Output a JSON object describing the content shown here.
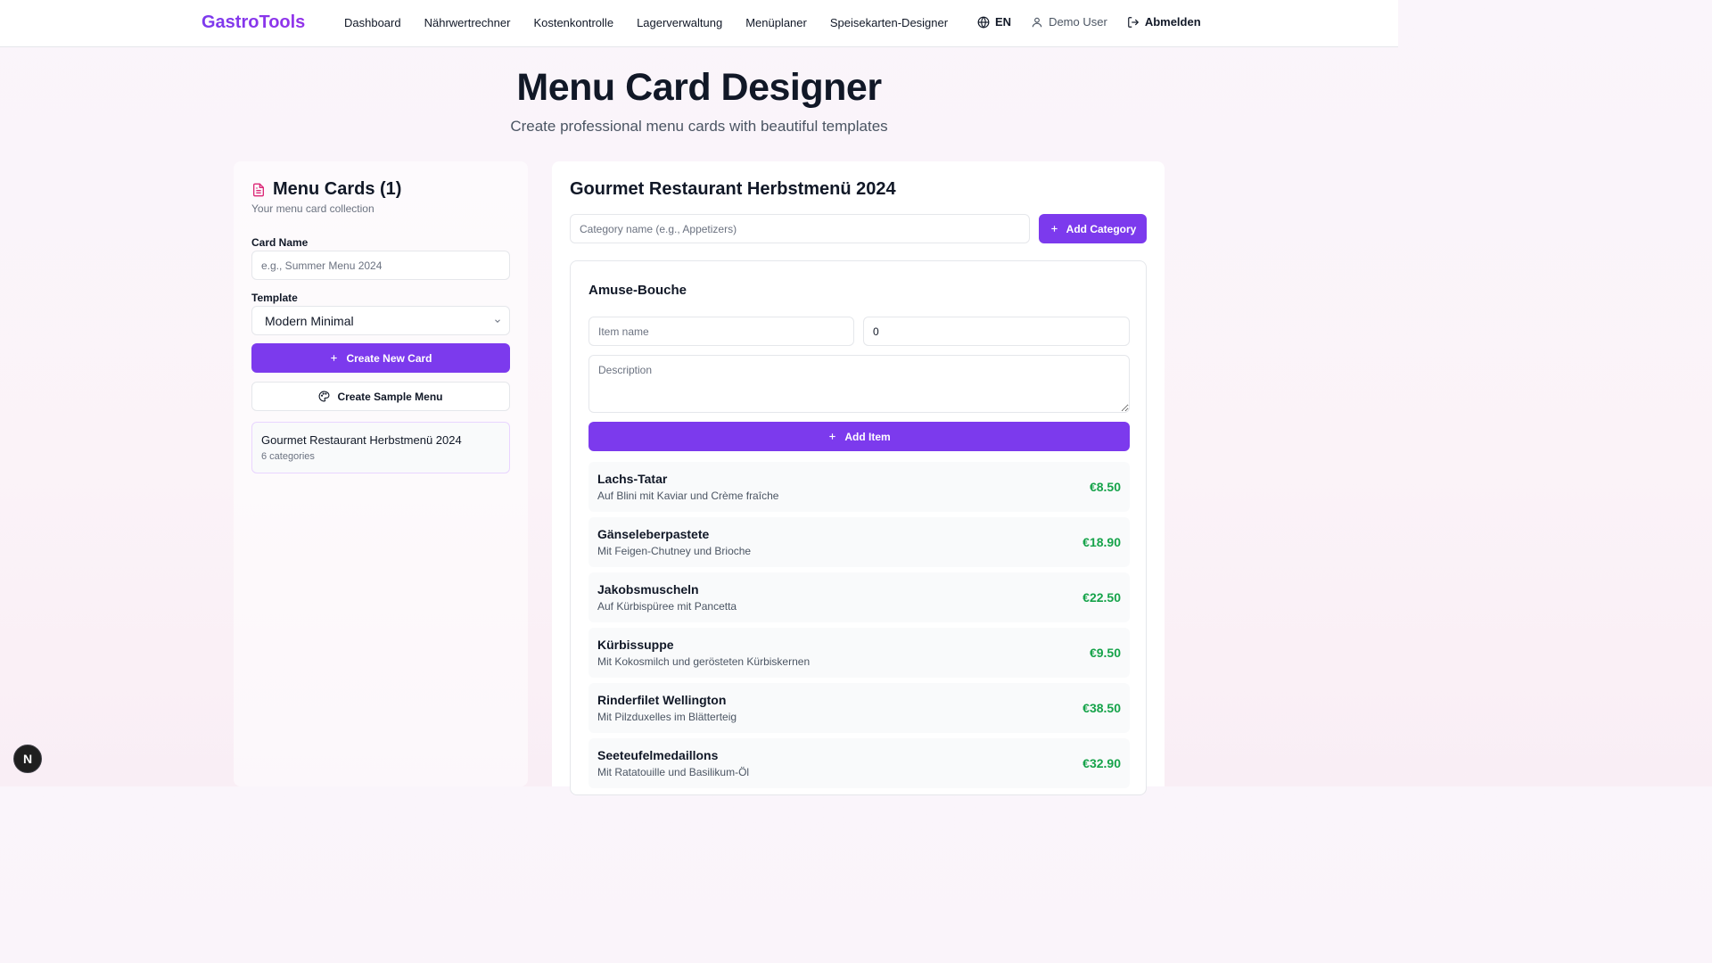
{
  "app": {
    "logo": "GastroTools"
  },
  "nav": {
    "links": [
      "Dashboard",
      "Nährwertrechner",
      "Kostenkontrolle",
      "Lagerverwaltung",
      "Menüplaner",
      "Speisekarten-Designer"
    ],
    "language": "EN",
    "user": "Demo User",
    "logout": "Abmelden"
  },
  "page": {
    "title": "Menu Card Designer",
    "subtitle": "Create professional menu cards with beautiful templates"
  },
  "left": {
    "title": "Menu Cards (1)",
    "description": "Your menu card collection",
    "card_name_label": "Card Name",
    "card_name_placeholder": "e.g., Summer Menu 2024",
    "template_label": "Template",
    "template_value": "Modern Minimal",
    "create_button": "Create New Card",
    "sample_button": "Create Sample Menu",
    "cards": [
      {
        "name": "Gourmet Restaurant Herbstmenü 2024",
        "meta": "6 categories"
      }
    ]
  },
  "right": {
    "title": "Gourmet Restaurant Herbstmenü 2024",
    "category_placeholder": "Category name (e.g., Appetizers)",
    "add_category_button": "Add Category",
    "category": {
      "name": "Amuse-Bouche",
      "item_name_placeholder": "Item name",
      "price_value": "0",
      "description_placeholder": "Description",
      "add_item_button": "Add Item",
      "items": [
        {
          "name": "Lachs-Tatar",
          "description": "Auf Blini mit Kaviar und Crème fraîche",
          "price": "€8.50"
        },
        {
          "name": "Gänseleberpastete",
          "description": "Mit Feigen-Chutney und Brioche",
          "price": "€18.90"
        },
        {
          "name": "Jakobsmuscheln",
          "description": "Auf Kürbispüree mit Pancetta",
          "price": "€22.50"
        },
        {
          "name": "Kürbissuppe",
          "description": "Mit Kokosmilch und gerösteten Kürbiskernen",
          "price": "€9.50"
        },
        {
          "name": "Rinderfilet Wellington",
          "description": "Mit Pilzduxelles im Blätterteig",
          "price": "€38.50"
        },
        {
          "name": "Seeteufelmedaillons",
          "description": "Mit Ratatouille und Basilikum-Öl",
          "price": "€32.90"
        }
      ]
    }
  },
  "badge": {
    "letter": "N"
  },
  "colors": {
    "accent": "#7c3aed",
    "price": "#16a34a",
    "icon_pink": "#db2777"
  }
}
